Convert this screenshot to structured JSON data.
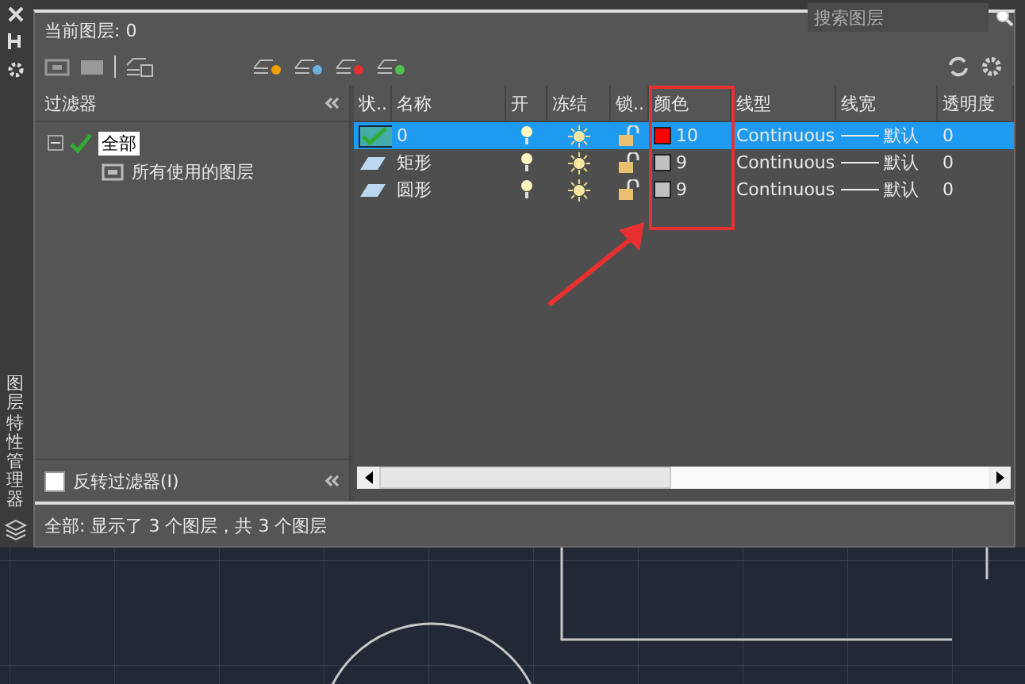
{
  "side_title": "图层特性管理器",
  "header": {
    "current_layer": "当前图层: 0",
    "search": {
      "placeholder": "搜索图层"
    }
  },
  "filters": {
    "title": "过滤器",
    "tree": [
      {
        "label": "全部",
        "selected": true,
        "expanded": true,
        "children": [
          {
            "label": "所有使用的图层",
            "selected": false
          }
        ]
      }
    ],
    "invert": {
      "label": "反转过滤器(I)",
      "checked": false
    }
  },
  "table": {
    "columns": [
      "状..",
      "名称",
      "开",
      "冻结",
      "锁..",
      "颜色",
      "线型",
      "线宽",
      "透明度"
    ],
    "rows": [
      {
        "current": true,
        "selected": true,
        "name": "0",
        "on": true,
        "frozen": false,
        "locked": false,
        "color": "#ff0000",
        "color_label": "10",
        "linetype": "Continuous",
        "lineweight": "默认",
        "transparency": "0"
      },
      {
        "current": false,
        "selected": false,
        "name": "矩形",
        "on": true,
        "frozen": false,
        "locked": false,
        "color": "#c0c0c0",
        "color_label": "9",
        "linetype": "Continuous",
        "lineweight": "默认",
        "transparency": "0"
      },
      {
        "current": false,
        "selected": false,
        "name": "圆形",
        "on": true,
        "frozen": false,
        "locked": false,
        "color": "#c0c0c0",
        "color_label": "9",
        "linetype": "Continuous",
        "lineweight": "默认",
        "transparency": "0"
      }
    ]
  },
  "status_bar": "全部: 显示了 3 个图层，共 3 个图层"
}
